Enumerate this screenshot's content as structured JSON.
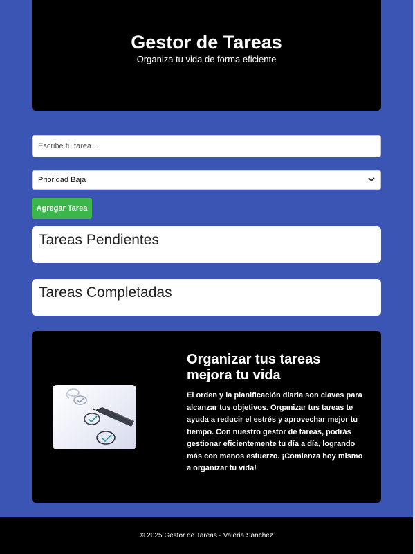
{
  "header": {
    "title": "Gestor de Tareas",
    "subtitle": "Organiza tu vida de forma eficiente"
  },
  "form": {
    "task_placeholder": "Escribe tu tarea...",
    "priority_selected": "Prioridad Baja",
    "add_button_label": "Agregar Tarea"
  },
  "sections": {
    "pending_title": "Tareas Pendientes",
    "completed_title": "Tareas Completadas"
  },
  "promo": {
    "title": "Organizar tus tareas mejora tu vida",
    "text": "El orden y la planificación diaria son claves para alcanzar tus objetivos. Organizar tus tareas te ayuda a reducir el estrés y aprovechar mejor tu tiempo. Con nuestro gestor de tareas, podrás gestionar eficientemente tu día a día, logrando más con menos esfuerzo. ¡Comienza hoy mismo a organizar tu vida!",
    "image_icon": "checklist-pen-image"
  },
  "footer": {
    "text": "© 2025 Gestor de Tareas - Valeria Sanchez"
  },
  "colors": {
    "page_background": "#3a55b4",
    "panel_dark": "#000000",
    "add_button": "#3cb54a"
  }
}
